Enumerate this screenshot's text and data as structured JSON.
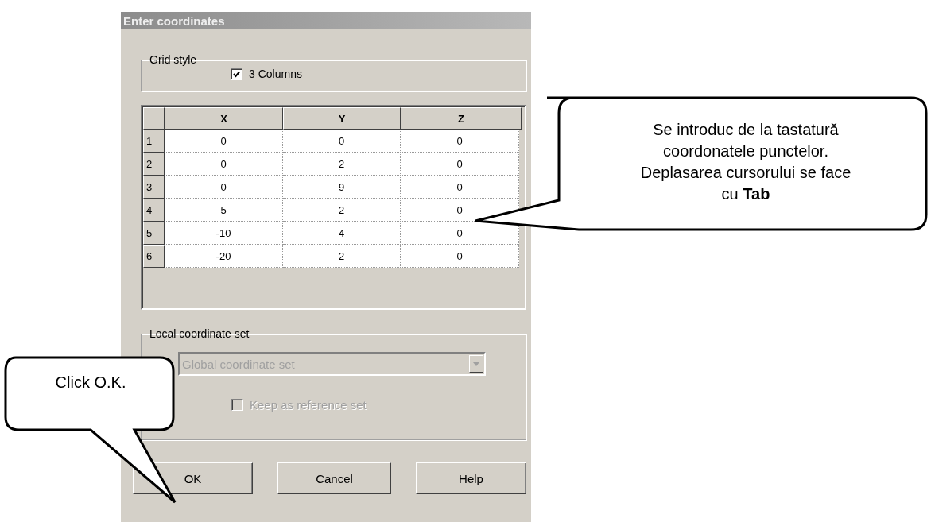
{
  "window": {
    "title": "Enter coordinates"
  },
  "grid_style": {
    "label": "Grid style",
    "checkbox": {
      "label": "3 Columns",
      "checked": true
    }
  },
  "table": {
    "columns": [
      "X",
      "Y",
      "Z"
    ],
    "rows": [
      {
        "number": "1",
        "cells": [
          "0",
          "0",
          "0"
        ]
      },
      {
        "number": "2",
        "cells": [
          "0",
          "2",
          "0"
        ]
      },
      {
        "number": "3",
        "cells": [
          "0",
          "9",
          "0"
        ]
      },
      {
        "number": "4",
        "cells": [
          "5",
          "2",
          "0"
        ]
      },
      {
        "number": "5",
        "cells": [
          "-10",
          "4",
          "0"
        ]
      },
      {
        "number": "6",
        "cells": [
          "-20",
          "2",
          "0"
        ]
      }
    ]
  },
  "local_coordinate_set": {
    "label": "Local coordinate set",
    "dropdown": {
      "value": "Global coordinate set",
      "disabled": true
    },
    "checkbox": {
      "label": "Keep as reference set",
      "checked": false,
      "disabled": true
    }
  },
  "buttons": [
    "OK",
    "Cancel",
    "Help"
  ],
  "callouts": [
    {
      "lines": [
        "Se introduc de la tastatură",
        "coordonatele punctelor.",
        "Deplasarea cursorului se face",
        "cu **Tab**"
      ]
    },
    {
      "lines": [
        "Click O.K."
      ]
    }
  ]
}
